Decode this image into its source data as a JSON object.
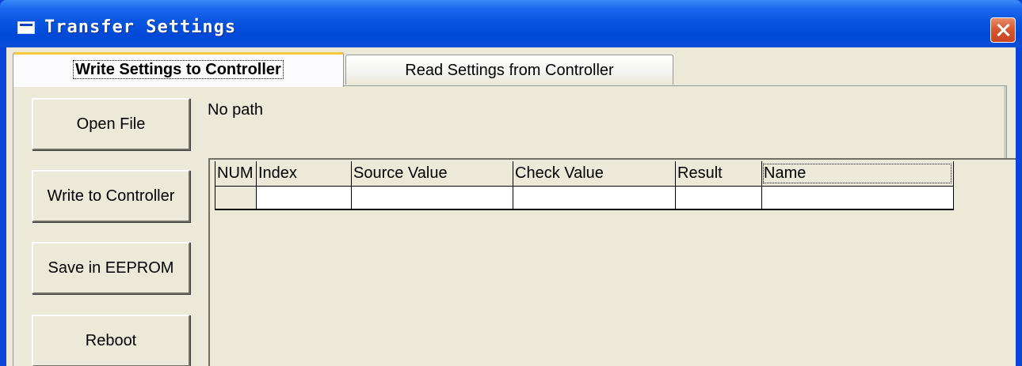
{
  "window": {
    "title": "Transfer Settings",
    "close_icon": "close-icon"
  },
  "tabs": [
    {
      "label": "Write Settings to Controller",
      "active": true
    },
    {
      "label": "Read Settings from Controller",
      "active": false
    }
  ],
  "buttons": {
    "open_file": "Open File",
    "write_to_controller": "Write to Controller",
    "save_in_eeprom": "Save in EEPROM",
    "reboot": "Reboot"
  },
  "file_path": "No path",
  "grid": {
    "columns": [
      "NUM",
      "Index",
      "Source Value",
      "Check Value",
      "Result",
      "Name"
    ],
    "rows": [
      [
        "",
        "",
        "",
        "",
        "",
        ""
      ]
    ]
  },
  "colors": {
    "titlebar": "#0a55e0",
    "client_background": "#ece9d8",
    "close_button": "#d6582f",
    "active_tab_highlight": "#ffc83c"
  }
}
